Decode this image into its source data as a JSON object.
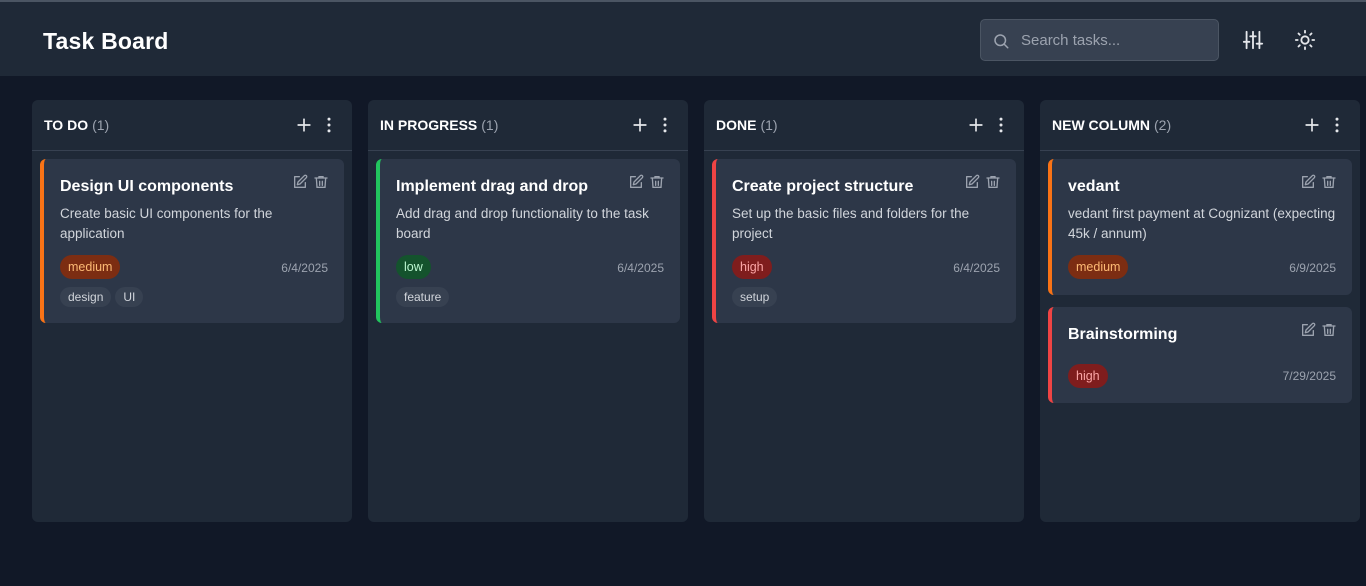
{
  "header": {
    "title": "Task Board",
    "search_placeholder": "Search tasks...",
    "filter_icon": "sliders-icon",
    "theme_icon": "sun-icon"
  },
  "colors": {
    "background": "#111827",
    "panel": "#1f2937",
    "card": "#2d3748",
    "priority_medium": "#f97316",
    "priority_low": "#22c55e",
    "priority_high": "#ef4444"
  },
  "columns": [
    {
      "name": "TO DO",
      "count": "(1)",
      "cards": [
        {
          "title": "Design UI components",
          "description": "Create basic UI components for the application",
          "priority": "medium",
          "date": "6/4/2025",
          "tags": [
            "design",
            "UI"
          ]
        }
      ]
    },
    {
      "name": "IN PROGRESS",
      "count": "(1)",
      "cards": [
        {
          "title": "Implement drag and drop",
          "description": "Add drag and drop functionality to the task board",
          "priority": "low",
          "date": "6/4/2025",
          "tags": [
            "feature"
          ]
        }
      ]
    },
    {
      "name": "DONE",
      "count": "(1)",
      "cards": [
        {
          "title": "Create project structure",
          "description": "Set up the basic files and folders for the project",
          "priority": "high",
          "date": "6/4/2025",
          "tags": [
            "setup"
          ]
        }
      ]
    },
    {
      "name": "NEW COLUMN",
      "count": "(2)",
      "cards": [
        {
          "title": "vedant",
          "description": "vedant first payment at Cognizant (expecting 45k / annum)",
          "priority": "medium",
          "date": "6/9/2025",
          "tags": []
        },
        {
          "title": "Brainstorming",
          "description": "",
          "priority": "high",
          "date": "7/29/2025",
          "tags": []
        }
      ]
    }
  ]
}
